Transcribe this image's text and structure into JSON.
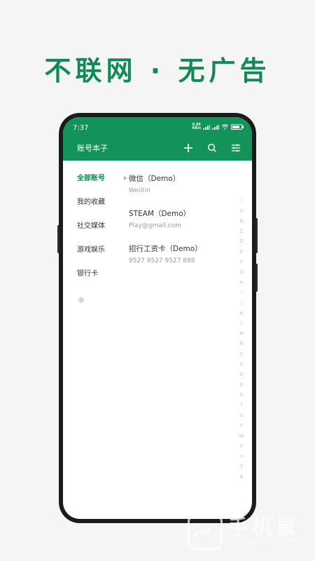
{
  "headline": "不联网 · 无广告",
  "status": {
    "time": "7:37",
    "speed_value": "0.95",
    "speed_unit": "KB/s"
  },
  "app": {
    "title": "账号本子"
  },
  "sidebar": {
    "items": [
      {
        "label": "全部账号",
        "active": true
      },
      {
        "label": "我的收藏"
      },
      {
        "label": "社交媒体"
      },
      {
        "label": "游戏娱乐"
      },
      {
        "label": "银行卡"
      }
    ]
  },
  "entries": [
    {
      "name": "微信（Demo）",
      "sub": "WeiXin"
    },
    {
      "name": "STEAM（Demo）",
      "sub": "Play@gmail.com"
    },
    {
      "name": "招行工资卡（Demo）",
      "sub": "9527 9527 9527 888"
    }
  ],
  "index_letters": [
    "☆",
    "A",
    "B",
    "C",
    "D",
    "E",
    "F",
    "G",
    "H",
    "I",
    "J",
    "K",
    "L",
    "M",
    "N",
    "O",
    "P",
    "Q",
    "R",
    "S",
    "T",
    "U",
    "V",
    "W",
    "X",
    "Y",
    "Z",
    "#"
  ],
  "watermark": {
    "cn": "手机鼠",
    "en": "SHOUJISHU.COM"
  },
  "colors": {
    "brand_green": "#12935a",
    "headline_green": "#118a55",
    "marker": "#e6a13a"
  }
}
